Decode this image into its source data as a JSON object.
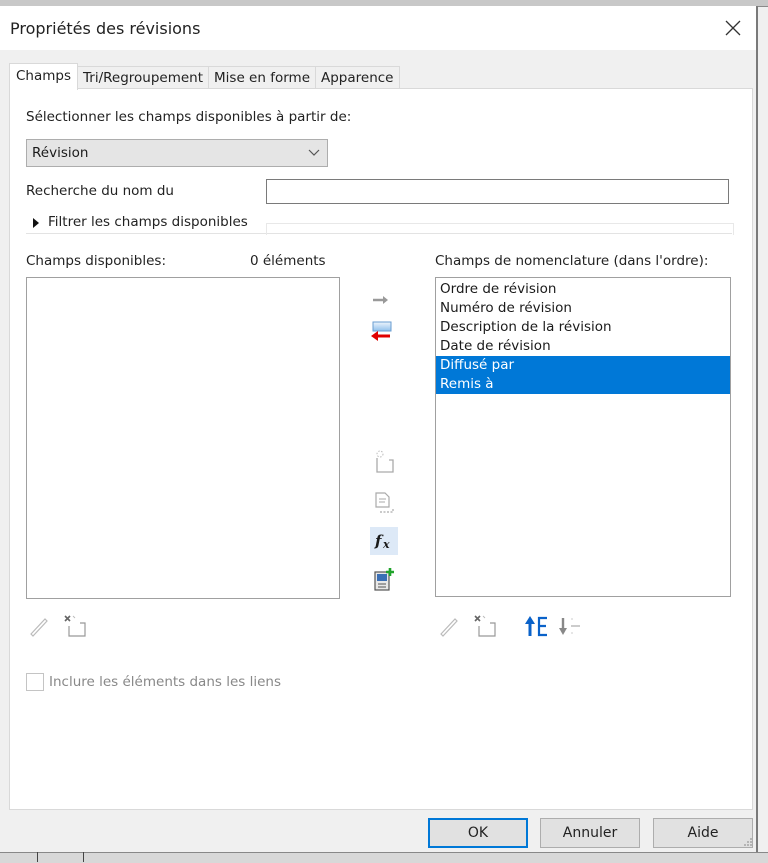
{
  "dialog": {
    "title": "Propriétés des révisions",
    "close_icon": "close-icon"
  },
  "tabs": [
    {
      "label": "Champs",
      "active": true
    },
    {
      "label": "Tri/Regroupement",
      "active": false
    },
    {
      "label": "Mise en forme",
      "active": false
    },
    {
      "label": "Apparence",
      "active": false
    }
  ],
  "fields_tab": {
    "source_label": "Sélectionner les champs disponibles à partir de:",
    "source_select": {
      "value": "Révision",
      "icon": "chevron-down-icon"
    },
    "search_label": "Recherche du nom du",
    "search_value": "",
    "filter_label": "Filtrer les champs disponibles",
    "filter_icon": "triangle-right-icon",
    "available": {
      "label": "Champs disponibles:",
      "count": "0 éléments",
      "items": []
    },
    "schedule": {
      "label": "Champs de nomenclature (dans l'ordre):",
      "items": [
        {
          "label": "Ordre de révision",
          "selected": false
        },
        {
          "label": "Numéro de révision",
          "selected": false
        },
        {
          "label": "Description de la révision",
          "selected": false
        },
        {
          "label": "Date de révision",
          "selected": false
        },
        {
          "label": "Diffusé par",
          "selected": true
        },
        {
          "label": "Remis à",
          "selected": true
        }
      ]
    },
    "middle_buttons": [
      {
        "name": "add-field-icon",
        "enabled": false
      },
      {
        "name": "remove-field-icon",
        "enabled": true
      },
      {
        "name": "new-parameter-icon",
        "enabled": false
      },
      {
        "name": "combine-parameters-icon",
        "enabled": false
      },
      {
        "name": "calculated-value-icon",
        "enabled": true
      },
      {
        "name": "add-shared-parameter-icon",
        "enabled": true
      }
    ],
    "available_tools": [
      {
        "name": "edit-parameter-icon",
        "enabled": false
      },
      {
        "name": "delete-parameter-icon",
        "enabled": false
      }
    ],
    "schedule_tools": [
      {
        "name": "edit-parameter-icon",
        "enabled": false
      },
      {
        "name": "delete-parameter-icon",
        "enabled": false
      },
      {
        "name": "move-up-icon",
        "enabled": true
      },
      {
        "name": "move-down-icon",
        "enabled": false
      }
    ],
    "include_links": {
      "label": "Inclure les éléments dans les liens",
      "checked": false,
      "enabled": false
    }
  },
  "footer": {
    "ok_label": "OK",
    "cancel_label": "Annuler",
    "help_label": "Aide"
  },
  "colors": {
    "selection": "#0078d7",
    "remove_arrow": "#e00000",
    "move_up": "#0a62c9",
    "add_green": "#1fa32a"
  }
}
